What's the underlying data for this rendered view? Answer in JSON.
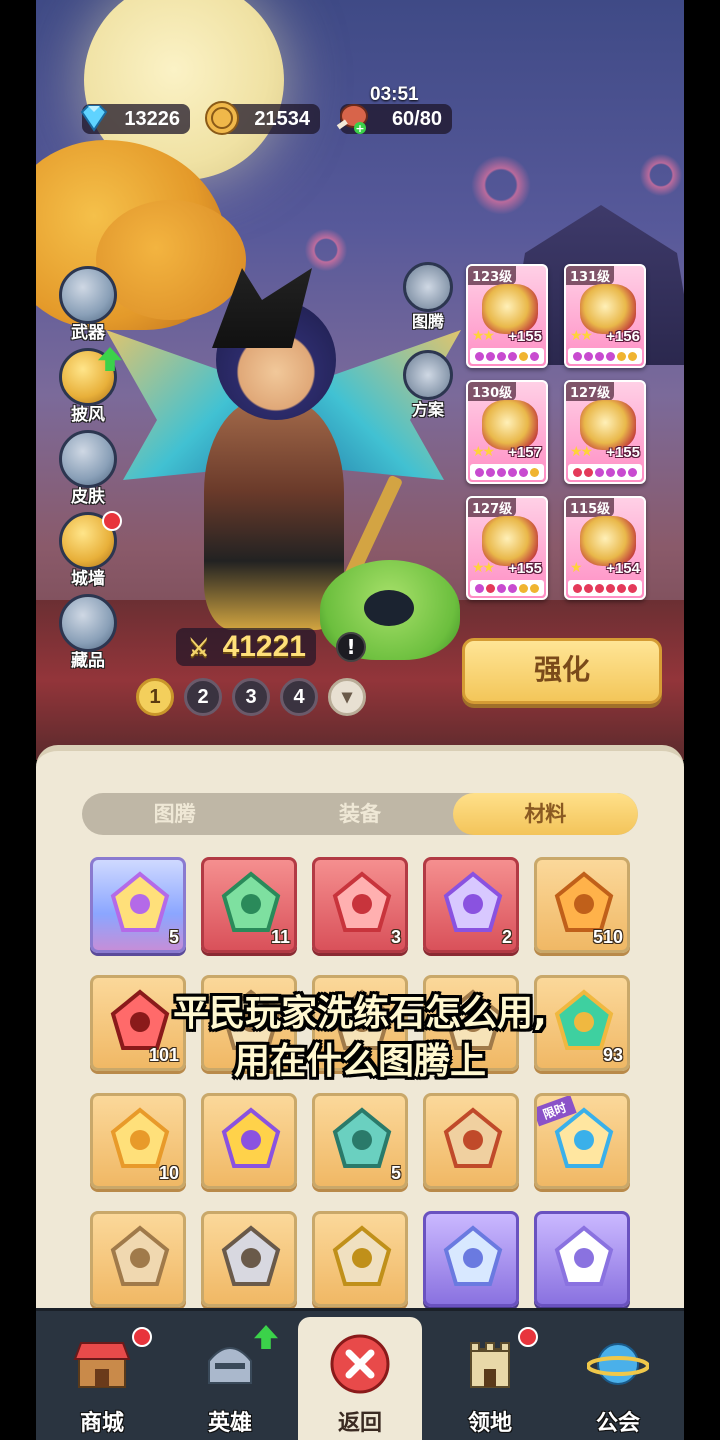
{
  "resources": {
    "diamonds": "13226",
    "coins": "21534",
    "stamina": "60/80",
    "stamina_timer": "03:51"
  },
  "side_menu": [
    "武器",
    "披风",
    "皮肤",
    "城墙",
    "藏品"
  ],
  "mid_menu": [
    "图腾",
    "方案"
  ],
  "equipment": [
    {
      "level": "123级",
      "stars": "★★",
      "bonus": "+155"
    },
    {
      "level": "131级",
      "stars": "★★",
      "bonus": "+156"
    },
    {
      "level": "130级",
      "stars": "★★",
      "bonus": "+157"
    },
    {
      "level": "127级",
      "stars": "★★",
      "bonus": "+155"
    },
    {
      "level": "127级",
      "stars": "★★",
      "bonus": "+155"
    },
    {
      "level": "115级",
      "stars": "★",
      "bonus": "+154"
    }
  ],
  "power": "41221",
  "pages": [
    "1",
    "2",
    "3",
    "4"
  ],
  "strengthen_label": "强化",
  "tabs": [
    "图腾",
    "装备",
    "材料"
  ],
  "active_tab": "材料",
  "items": [
    {
      "icon": "star-crystal-icon",
      "count": "5",
      "style": "blue"
    },
    {
      "icon": "green-ticket-icon",
      "count": "11",
      "style": "red"
    },
    {
      "icon": "winged-gem-icon",
      "count": "3",
      "style": "red"
    },
    {
      "icon": "prism-gem-icon",
      "count": "2",
      "style": "red"
    },
    {
      "icon": "amber-stone-icon",
      "count": "510",
      "style": "gold"
    },
    {
      "icon": "red-orb-icon",
      "count": "101",
      "style": "gold"
    },
    {
      "icon": "scroll-icon",
      "count": "",
      "style": "gold"
    },
    {
      "icon": "scroll-icon",
      "count": "",
      "style": "gold"
    },
    {
      "icon": "scroll-icon",
      "count": "",
      "style": "gold"
    },
    {
      "icon": "magic-lamp-icon",
      "count": "93",
      "style": "gold"
    },
    {
      "icon": "winged-star-icon",
      "count": "10",
      "style": "gold"
    },
    {
      "icon": "golden-key-icon",
      "count": "",
      "style": "gold"
    },
    {
      "icon": "feather-wand-icon",
      "count": "5",
      "style": "gold"
    },
    {
      "icon": "treasure-scroll-icon",
      "count": "",
      "style": "gold"
    },
    {
      "icon": "voucher-icon",
      "count": "",
      "style": "gold",
      "tag": "限时"
    },
    {
      "icon": "jar-icon",
      "count": "",
      "style": "gold"
    },
    {
      "icon": "axe-icon",
      "count": "",
      "style": "gold"
    },
    {
      "icon": "map-scroll-icon",
      "count": "",
      "style": "gold"
    },
    {
      "icon": "ring-icon",
      "count": "",
      "style": "purple"
    },
    {
      "icon": "document-icon",
      "count": "",
      "style": "purple"
    }
  ],
  "caption": [
    "平民玩家洗练石怎么用,",
    "用在什么图腾上"
  ],
  "nav": [
    {
      "label": "商城",
      "icon": "shop-icon"
    },
    {
      "label": "英雄",
      "icon": "hero-helmet-icon"
    },
    {
      "label": "返回",
      "icon": "close-icon"
    },
    {
      "label": "领地",
      "icon": "castle-icon"
    },
    {
      "label": "公会",
      "icon": "planet-icon"
    }
  ]
}
